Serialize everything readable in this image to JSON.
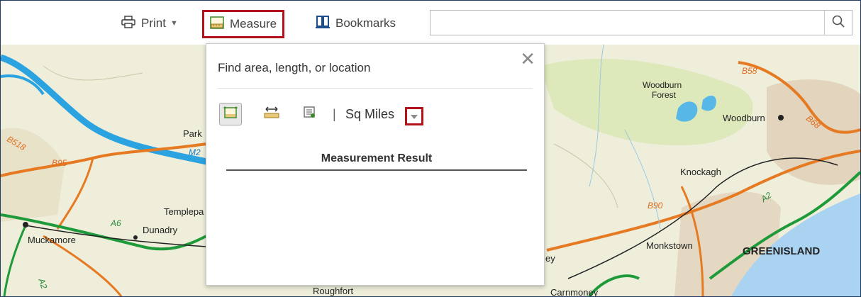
{
  "toolbar": {
    "print_label": "Print",
    "measure_label": "Measure",
    "bookmarks_label": "Bookmarks",
    "search_placeholder": "",
    "icons": {
      "print": "printer-icon",
      "measure": "ruler-icon",
      "bookmarks": "bookmark-icon",
      "search": "search-icon"
    }
  },
  "map": {
    "labels": {
      "park": "Park",
      "m2": "M2",
      "b95": "B95",
      "b518": "B518",
      "templepatrick": "Templepa",
      "a6": "A6",
      "dunadry": "Dunadry",
      "muckamore": "Muckamore",
      "a2_left": "A2",
      "woodburn_forest_1": "Woodburn",
      "woodburn_forest_2": "Forest",
      "woodburn": "Woodburn",
      "b58": "B58",
      "b68": "B68",
      "knockagh": "Knockagh",
      "b90": "B90",
      "a2_right": "A2",
      "monkstown": "Monkstown",
      "greenisland": "GREENISLAND",
      "ey": "ey",
      "roughfort": "Roughfort",
      "carnmoney": "Carnmoney"
    },
    "colors": {
      "land": "#eeeedb",
      "sea": "#a9d3f0",
      "motorway": "#2aa3e0",
      "a_road": "#1f9a3a",
      "b_road": "#e67a22",
      "forest": "#d9e6b5",
      "urban": "#dccfb8"
    }
  },
  "measure_panel": {
    "title": "Find area, length, or location",
    "close_icon": "close-icon",
    "tools": {
      "area": "area-measure-icon",
      "distance": "distance-measure-icon",
      "location": "location-measure-icon"
    },
    "unit_separator": "|",
    "unit_value": "Sq Miles",
    "unit_dropdown_icon": "chevron-down-icon",
    "result_title": "Measurement Result"
  }
}
